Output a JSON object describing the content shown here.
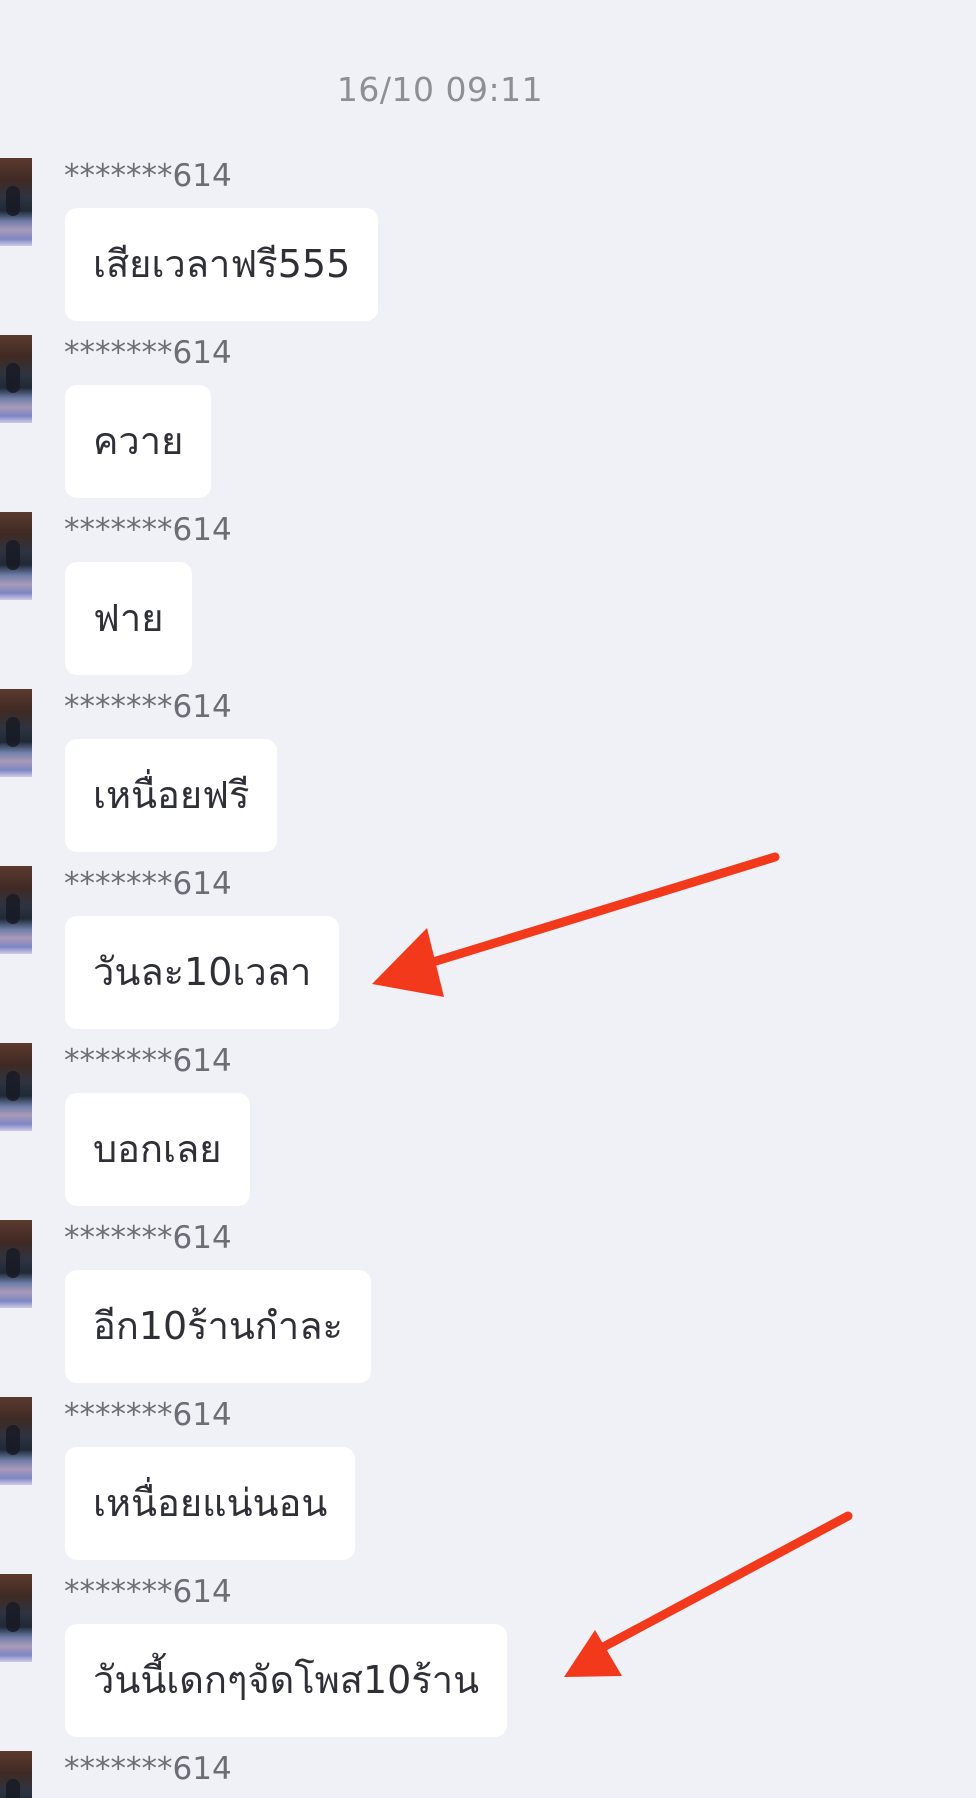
{
  "timestamp": "16/10 09:11",
  "messages": [
    {
      "sender": "*******614",
      "text": "เสียเวลาฟรี555"
    },
    {
      "sender": "*******614",
      "text": "ควาย"
    },
    {
      "sender": "*******614",
      "text": "ฟาย"
    },
    {
      "sender": "*******614",
      "text": "เหนื่อยฟรี"
    },
    {
      "sender": "*******614",
      "text": "วันละ10เวลา"
    },
    {
      "sender": "*******614",
      "text": "บอกเลย"
    },
    {
      "sender": "*******614",
      "text": "อีก10ร้านกำละ"
    },
    {
      "sender": "*******614",
      "text": "เหนื่อยแน่นอน"
    },
    {
      "sender": "*******614",
      "text": "วันนี้เดกๆจัดโพส10ร้าน"
    },
    {
      "sender": "*******614",
      "text": ""
    }
  ],
  "colors": {
    "background": "#f0f1f6",
    "bubble": "#ffffff",
    "annotation_arrow": "#f2391b"
  }
}
